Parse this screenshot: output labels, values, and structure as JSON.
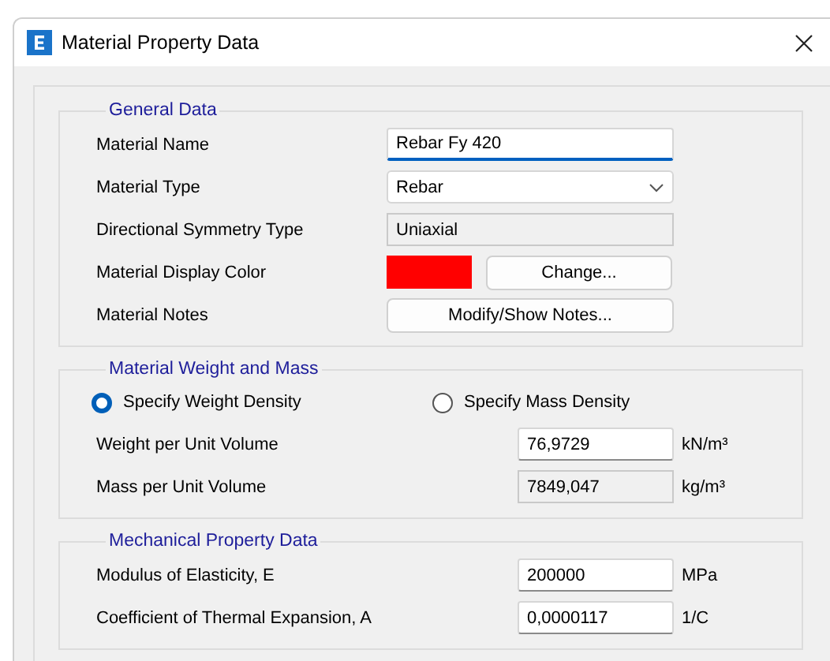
{
  "window": {
    "title": "Material Property Data"
  },
  "general_data": {
    "title": "General Data",
    "rows": [
      {
        "label": "Material Name",
        "kind": "text",
        "value": "Rebar Fy 420",
        "focused": true
      },
      {
        "label": "Material Type",
        "kind": "dropdown",
        "value": "Rebar"
      },
      {
        "label": "Directional Symmetry Type",
        "kind": "readonly",
        "value": "Uniaxial"
      },
      {
        "label": "Material Display Color",
        "kind": "color",
        "color": "#ff0000",
        "button": "Change..."
      },
      {
        "label": "Material Notes",
        "kind": "button",
        "button": "Modify/Show Notes..."
      }
    ]
  },
  "weight_and_mass": {
    "title": "Material Weight and Mass",
    "options": [
      {
        "label": "Specify Weight Density",
        "selected": true
      },
      {
        "label": "Specify Mass Density",
        "selected": false
      }
    ],
    "rows": [
      {
        "label": "Weight per Unit Volume",
        "kind": "text",
        "value": "76,9729",
        "unit": "kN/m³",
        "focused": false
      },
      {
        "label": "Mass per Unit Volume",
        "kind": "readonly",
        "value": "7849,047",
        "unit": "kg/m³"
      }
    ]
  },
  "mechanical_property_data": {
    "title": "Mechanical Property Data",
    "rows": [
      {
        "label": "Modulus of Elasticity,  E",
        "kind": "text",
        "value": "200000",
        "unit": "MPa",
        "focused": false
      },
      {
        "label": "Coefficient of Thermal Expansion,  A",
        "kind": "text",
        "value": "0,0000117",
        "unit": "1/C",
        "focused": false
      }
    ]
  }
}
